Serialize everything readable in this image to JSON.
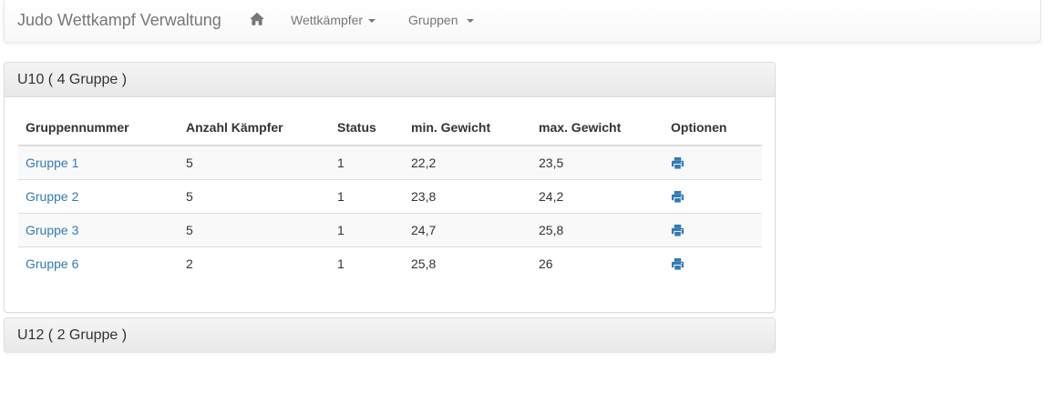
{
  "navbar": {
    "brand": "Judo Wettkampf Verwaltung",
    "home_icon": "home-icon",
    "menus": [
      {
        "label": "Wettkämpfer"
      },
      {
        "label": "Gruppen"
      }
    ]
  },
  "panels": [
    {
      "title": "U10 ( 4 Gruppe )",
      "columns": [
        "Gruppennummer",
        "Anzahl Kämpfer",
        "Status",
        "min. Gewicht",
        "max. Gewicht",
        "Optionen"
      ],
      "rows": [
        {
          "name": "Gruppe 1",
          "count": "5",
          "status": "1",
          "min": "22,2",
          "max": "23,5",
          "option_icon": "print-icon"
        },
        {
          "name": "Gruppe 2",
          "count": "5",
          "status": "1",
          "min": "23,8",
          "max": "24,2",
          "option_icon": "print-icon"
        },
        {
          "name": "Gruppe 3",
          "count": "5",
          "status": "1",
          "min": "24,7",
          "max": "25,8",
          "option_icon": "print-icon"
        },
        {
          "name": "Gruppe 6",
          "count": "2",
          "status": "1",
          "min": "25,8",
          "max": "26",
          "option_icon": "print-icon"
        }
      ]
    },
    {
      "title": "U12 ( 2 Gruppe )"
    }
  ],
  "colors": {
    "link": "#337ab7",
    "icon": "#337ab7",
    "nav_text": "#777777",
    "text": "#333333"
  }
}
